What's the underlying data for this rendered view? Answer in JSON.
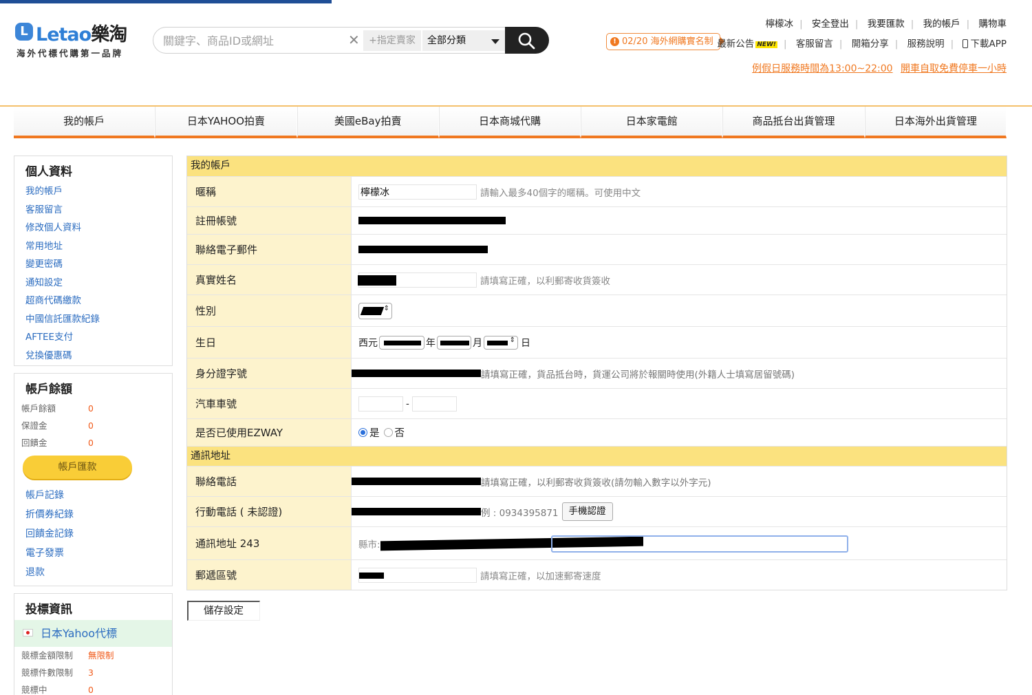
{
  "brand": {
    "logo_text_a": "Letao",
    "logo_text_b": "樂淘",
    "tagline": "海外代標代購第一品牌"
  },
  "search": {
    "placeholder": "關鍵字、商品ID或網址",
    "seller_label": "+指定賣家",
    "category": "全部分類"
  },
  "toplinks": [
    "檸檬冰",
    "安全登出",
    "我要匯款",
    "我的帳戶",
    "購物車"
  ],
  "notice": {
    "label": "02/20 海外網購實名制"
  },
  "sublinks": {
    "announce": "最新公告",
    "new_tag": "NEW!",
    "service": "客服留言",
    "share": "開箱分享",
    "help": "服務說明",
    "app": "下載APP"
  },
  "promo": [
    "例假日服務時間為13:00~22:00",
    "開車自取免費停車一小時"
  ],
  "nav": [
    "我的帳戶",
    "日本YAHOO拍賣",
    "美國eBay拍賣",
    "日本商城代購",
    "日本家電館",
    "商品抵台出貨管理",
    "日本海外出貨管理"
  ],
  "sidebar": {
    "profile": {
      "title": "個人資料",
      "links": [
        "我的帳戶",
        "客服留言",
        "修改個人資料",
        "常用地址",
        "變更密碼",
        "通知設定",
        "超商代碼繳款",
        "中國信託匯款紀錄",
        "AFTEE支付",
        "兌換優惠碼"
      ]
    },
    "balance": {
      "title": "帳戶餘額",
      "rows": [
        {
          "label": "帳戶餘額",
          "value": "0"
        },
        {
          "label": "保證金",
          "value": "0"
        },
        {
          "label": "回饋金",
          "value": "0"
        }
      ],
      "pay_button": "帳戶匯款",
      "links": [
        "帳戶記錄",
        "折價券紀錄",
        "回饋金記錄",
        "電子發票",
        "退款"
      ]
    },
    "bidding": {
      "title": "投標資訊",
      "site": "日本Yahoo代標",
      "rows": [
        {
          "label": "競標金額限制",
          "value": "無限制"
        },
        {
          "label": "競標件數限制",
          "value": "3"
        },
        {
          "label": "競標中",
          "value": "0"
        }
      ]
    }
  },
  "form": {
    "section_account": "我的帳戶",
    "nickname": {
      "label": "暱稱",
      "value": "檸檬冰",
      "hint": "請輸入最多40個字的暱稱。可使用中文"
    },
    "account_id": {
      "label": "註冊帳號"
    },
    "email": {
      "label": "聯絡電子郵件"
    },
    "real_name": {
      "label": "真實姓名",
      "hint": "請填寫正確，以利郵寄收貨簽收"
    },
    "gender": {
      "label": "性別"
    },
    "birthday": {
      "label": "生日",
      "era": "西元",
      "unit_year": "年",
      "unit_month": "月",
      "unit_day": "日"
    },
    "id_number": {
      "label": "身分證字號",
      "hint": "請填寫正確，貨品抵台時，貨運公司將於報關時使用(外籍人士填寫居留號碼)"
    },
    "car_plate": {
      "label": "汽車車號",
      "dash": "-"
    },
    "ezway": {
      "label": "是否已使用EZWAY",
      "yes": "是",
      "no": "否"
    },
    "section_address": "通訊地址",
    "phone": {
      "label": "聯絡電話",
      "hint": "請填寫正確，以利郵寄收貨簽收(請勿輸入數字以外字元)"
    },
    "mobile": {
      "label": "行動電話 ( 未認證)",
      "hint": "例 : 0934395871",
      "verify_button": "手機認證"
    },
    "address": {
      "label": "通訊地址 243",
      "city_label": "縣市:"
    },
    "zip": {
      "label": "郵遞區號",
      "hint": "請填寫正確，以加速郵寄速度"
    },
    "save_button": "儲存設定"
  },
  "colors": {
    "accent": "#f07820",
    "brand_blue": "#2f7fd6",
    "section_yellow": "#fbe27f",
    "label_bg": "#fdf3cd",
    "link_blue": "#2b6cc0"
  }
}
